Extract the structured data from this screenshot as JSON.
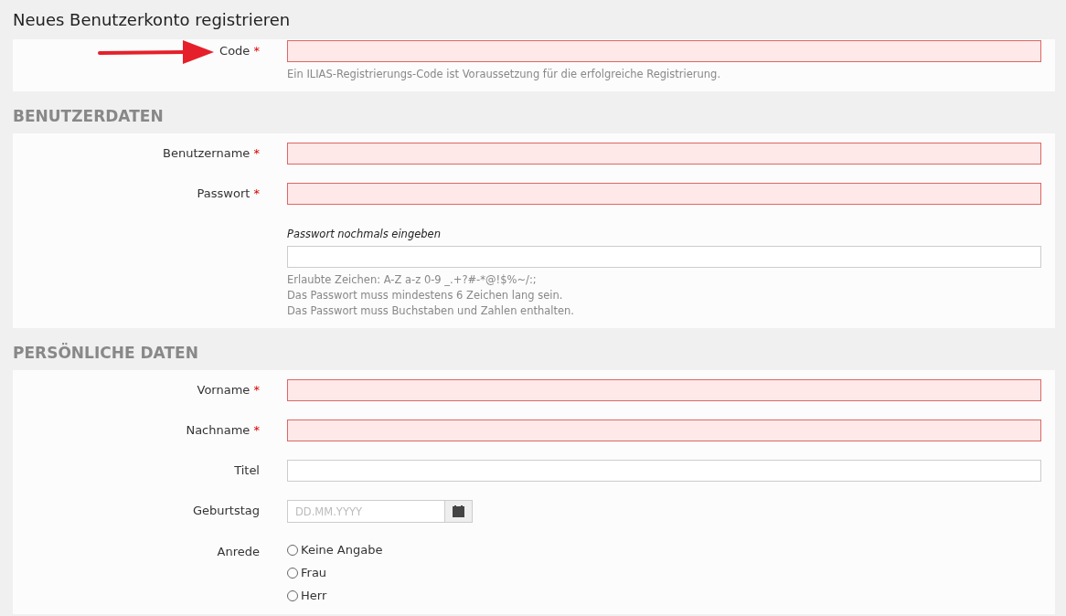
{
  "title": "Neues Benutzerkonto registrieren",
  "sections": [
    {
      "fields": [
        {
          "kind": "text",
          "label": "Code",
          "mark": "*",
          "invalid": true,
          "hints": [
            "Ein ILIAS-Registrierungs-Code ist Voraussetzung für die erfolgreiche Registrierung."
          ]
        }
      ]
    },
    {
      "heading": "BENUTZERDATEN",
      "fields": [
        {
          "kind": "text",
          "label": "Benutzername",
          "mark": "*",
          "invalid": true
        },
        {
          "kind": "text",
          "label": "Passwort",
          "mark": "*",
          "invalid": true
        },
        {
          "kind": "confirm",
          "sublabel": "Passwort nochmals eingeben",
          "invalid": false,
          "hints": [
            "Erlaubte Zeichen: A-Z a-z 0-9 _.+?#-*@!$%~/:;",
            "Das Passwort muss mindestens 6 Zeichen lang sein.",
            "Das Passwort muss Buchstaben und Zahlen enthalten."
          ]
        }
      ]
    },
    {
      "heading": "PERSÖNLICHE DATEN",
      "fields": [
        {
          "kind": "text",
          "label": "Vorname",
          "mark": "*",
          "invalid": true
        },
        {
          "kind": "text",
          "label": "Nachname",
          "mark": "*",
          "invalid": true
        },
        {
          "kind": "text",
          "label": "Titel",
          "invalid": false
        },
        {
          "kind": "date",
          "label": "Geburtstag",
          "placeholder": "DD.MM.YYYY"
        },
        {
          "kind": "radio",
          "label": "Anrede",
          "options": [
            {
              "label": "Keine Angabe",
              "selected": false
            },
            {
              "label": "Frau",
              "selected": false
            },
            {
              "label": "Herr",
              "selected": false
            }
          ]
        }
      ]
    }
  ]
}
